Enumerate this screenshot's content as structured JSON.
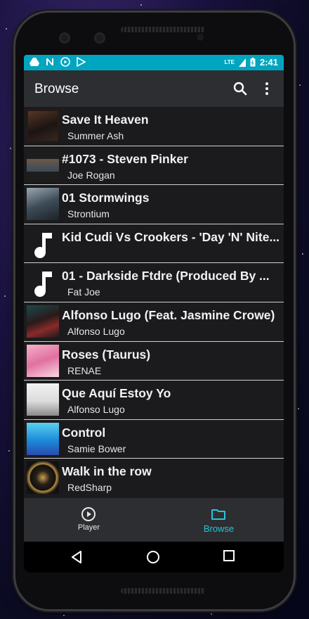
{
  "status_bar": {
    "left_icons": [
      "drive-icon",
      "n-icon",
      "play-circle-icon",
      "play-store-icon"
    ],
    "network": "LTE",
    "time": "2:41"
  },
  "app_bar": {
    "title": "Browse",
    "search_icon": "search-icon",
    "more_icon": "more-vert-icon"
  },
  "tracks": [
    {
      "title": "Save It Heaven",
      "artist": "Summer Ash",
      "art": "album-art"
    },
    {
      "title": "#1073 - Steven Pinker",
      "artist": "Joe Rogan",
      "art": "album-art"
    },
    {
      "title": "01 Stormwings",
      "artist": "Strontium",
      "art": "album-art"
    },
    {
      "title": "Kid Cudi Vs Crookers - 'Day 'N' Nite...",
      "artist": "",
      "art": "music-note-icon"
    },
    {
      "title": "01 - Darkside Ftdre (Produced By ...",
      "artist": "Fat Joe",
      "art": "music-note-icon"
    },
    {
      "title": "Alfonso Lugo (Feat. Jasmine Crowe)",
      "artist": "Alfonso Lugo",
      "art": "album-art"
    },
    {
      "title": "Roses (Taurus)",
      "artist": "RENAE",
      "art": "album-art"
    },
    {
      "title": "Que Aquí Estoy Yo",
      "artist": "Alfonso Lugo",
      "art": "album-art"
    },
    {
      "title": "Control",
      "artist": "Samie Bower",
      "art": "album-art"
    },
    {
      "title": "Walk in the row",
      "artist": "RedSharp",
      "art": "album-art"
    }
  ],
  "bottom_nav": {
    "player_label": "Player",
    "browse_label": "Browse",
    "active": "Browse"
  },
  "colors": {
    "accent": "#26c6da",
    "status_bar": "#00a5bf",
    "app_bar": "#2d2e31",
    "list_background": "#1b1b1d"
  }
}
